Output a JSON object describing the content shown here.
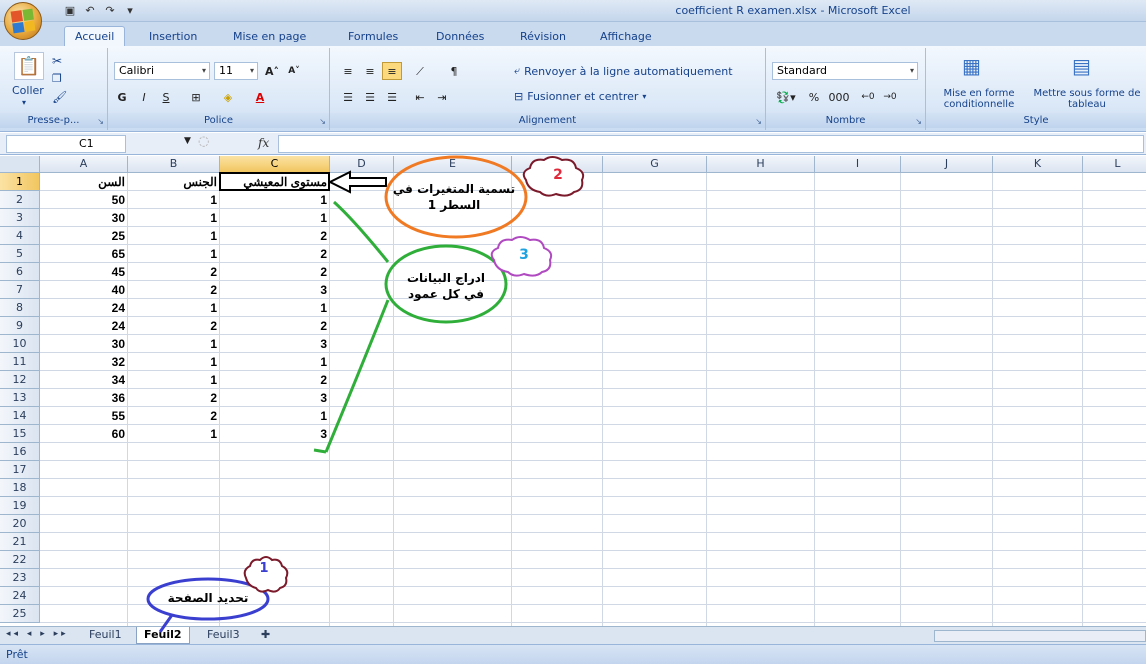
{
  "window": {
    "title": "coefficient R examen.xlsx - Microsoft Excel"
  },
  "tabs": [
    {
      "label": "Accueil",
      "active": true
    },
    {
      "label": "Insertion"
    },
    {
      "label": "Mise en page"
    },
    {
      "label": "Formules"
    },
    {
      "label": "Données"
    },
    {
      "label": "Révision"
    },
    {
      "label": "Affichage"
    }
  ],
  "ribbon": {
    "clipboard": {
      "paste_label": "Coller",
      "group_label": "Presse-p..."
    },
    "font": {
      "font_name": "Calibri",
      "font_size": "11",
      "group_label": "Police",
      "bold": "G",
      "italic": "I",
      "underline": "S"
    },
    "alignment": {
      "wrap_text": "Renvoyer à la ligne automatiquement",
      "merge_center": "Fusionner et centrer",
      "group_label": "Alignement"
    },
    "number": {
      "format": "Standard",
      "percent": "%",
      "thousands": "000",
      "group_label": "Nombre"
    },
    "style": {
      "conditional": "Mise en forme conditionnelle",
      "table": "Mettre sous forme de tableau",
      "group_label": "Style"
    }
  },
  "formula_bar": {
    "name_box": "C1",
    "fx": "fx"
  },
  "columns": [
    "A",
    "B",
    "C",
    "D",
    "E",
    "F",
    "G",
    "H",
    "I",
    "J",
    "K",
    "L"
  ],
  "rows": [
    "1",
    "2",
    "3",
    "4",
    "5",
    "6",
    "7",
    "8",
    "9",
    "10",
    "11",
    "12",
    "13",
    "14",
    "15",
    "16",
    "17",
    "18",
    "19",
    "20",
    "21",
    "22",
    "23",
    "24",
    "25"
  ],
  "sheet": {
    "headers": {
      "A": "السن",
      "B": "الجنس",
      "C": "مستوى المعيشي"
    },
    "A": [
      50,
      30,
      25,
      65,
      45,
      40,
      24,
      24,
      30,
      32,
      34,
      36,
      55,
      60
    ],
    "B": [
      1,
      1,
      1,
      1,
      2,
      2,
      1,
      2,
      1,
      1,
      1,
      2,
      2,
      1
    ],
    "C": [
      1,
      1,
      2,
      2,
      2,
      3,
      1,
      2,
      3,
      1,
      2,
      3,
      1,
      3
    ]
  },
  "annotations": {
    "a1": {
      "number": "1",
      "text": "تحديد الصفحة",
      "color": "#3b3fd0"
    },
    "a2": {
      "number": "2",
      "text": "تسمية المتغيرات في السطر 1",
      "color": "#f07a24"
    },
    "a3": {
      "number": "3",
      "text": "ادراج البيانات في كل عمود",
      "color": "#2fae3a"
    }
  },
  "sheet_tabs": [
    {
      "label": "Feuil1"
    },
    {
      "label": "Feuil2",
      "active": true
    },
    {
      "label": "Feuil3"
    }
  ],
  "status": {
    "text": "Prêt"
  }
}
